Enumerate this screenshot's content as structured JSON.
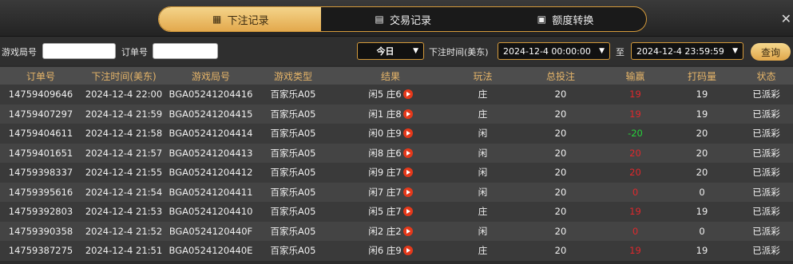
{
  "tabs": [
    {
      "label": "下注记录",
      "icon": "calendar-icon"
    },
    {
      "label": "交易记录",
      "icon": "document-icon"
    },
    {
      "label": "额度转换",
      "icon": "money-transfer-icon"
    }
  ],
  "filter": {
    "game_round_label": "游戏局号",
    "order_label": "订单号",
    "date_preset": "今日",
    "time_label": "下注时间(美东)",
    "start_time": "2024-12-4 00:00:00",
    "to_label": "至",
    "end_time": "2024-12-4 23:59:59",
    "query_label": "查询"
  },
  "table": {
    "headers": [
      "订单号",
      "下注时间(美东)",
      "游戏局号",
      "游戏类型",
      "结果",
      "玩法",
      "总投注",
      "输赢",
      "打码量",
      "状态"
    ],
    "rows": [
      {
        "order": "14759409646",
        "time": "2024-12-4 22:00",
        "round": "BGA05241204416",
        "type": "百家乐A05",
        "result": "闲5 庄6",
        "bet": "庄",
        "total": "20",
        "win": "19",
        "turnover": "19",
        "status": "已派彩"
      },
      {
        "order": "14759407297",
        "time": "2024-12-4 21:59",
        "round": "BGA05241204415",
        "type": "百家乐A05",
        "result": "闲1 庄8",
        "bet": "庄",
        "total": "20",
        "win": "19",
        "turnover": "19",
        "status": "已派彩"
      },
      {
        "order": "14759404611",
        "time": "2024-12-4 21:58",
        "round": "BGA05241204414",
        "type": "百家乐A05",
        "result": "闲0 庄9",
        "bet": "闲",
        "total": "20",
        "win": "-20",
        "turnover": "20",
        "status": "已派彩"
      },
      {
        "order": "14759401651",
        "time": "2024-12-4 21:57",
        "round": "BGA05241204413",
        "type": "百家乐A05",
        "result": "闲8 庄6",
        "bet": "闲",
        "total": "20",
        "win": "20",
        "turnover": "20",
        "status": "已派彩"
      },
      {
        "order": "14759398337",
        "time": "2024-12-4 21:55",
        "round": "BGA05241204412",
        "type": "百家乐A05",
        "result": "闲9 庄7",
        "bet": "闲",
        "total": "20",
        "win": "20",
        "turnover": "20",
        "status": "已派彩"
      },
      {
        "order": "14759395616",
        "time": "2024-12-4 21:54",
        "round": "BGA05241204411",
        "type": "百家乐A05",
        "result": "闲7 庄7",
        "bet": "闲",
        "total": "20",
        "win": "0",
        "turnover": "0",
        "status": "已派彩"
      },
      {
        "order": "14759392803",
        "time": "2024-12-4 21:53",
        "round": "BGA05241204410",
        "type": "百家乐A05",
        "result": "闲5 庄7",
        "bet": "庄",
        "total": "20",
        "win": "19",
        "turnover": "19",
        "status": "已派彩"
      },
      {
        "order": "14759390358",
        "time": "2024-12-4 21:52",
        "round": "BGA0524120440F",
        "type": "百家乐A05",
        "result": "闲2 庄2",
        "bet": "闲",
        "total": "20",
        "win": "0",
        "turnover": "0",
        "status": "已派彩"
      },
      {
        "order": "14759387275",
        "time": "2024-12-4 21:51",
        "round": "BGA0524120440E",
        "type": "百家乐A05",
        "result": "闲6 庄9",
        "bet": "庄",
        "total": "20",
        "win": "19",
        "turnover": "19",
        "status": "已派彩"
      }
    ]
  },
  "colors": {
    "accent": "#e3a94d",
    "win": "#e0282c",
    "loss": "#27d13b"
  }
}
